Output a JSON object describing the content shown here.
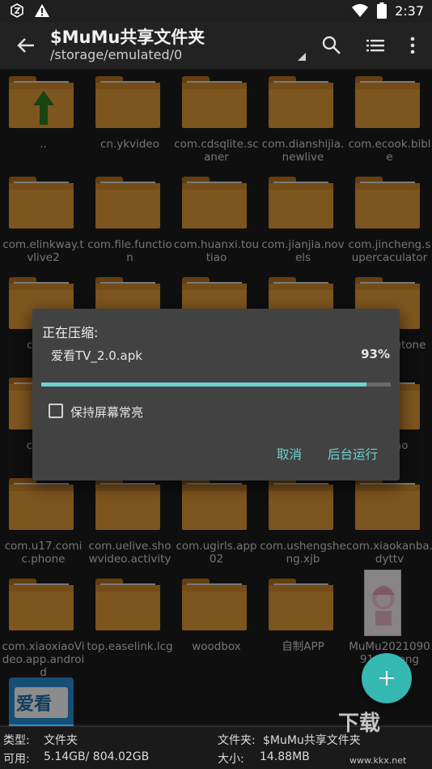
{
  "status_bar": {
    "time": "2:37"
  },
  "appbar": {
    "title": "$MuMu共享文件夹",
    "path": "/storage/emulated/0"
  },
  "files": [
    {
      "name": "..",
      "kind": "up"
    },
    {
      "name": "cn.ykvideo",
      "kind": "folder"
    },
    {
      "name": "com.cdsqlite.scaner",
      "kind": "folder"
    },
    {
      "name": "com.dianshijia.newlive",
      "kind": "folder"
    },
    {
      "name": "com.ecook.bible",
      "kind": "folder"
    },
    {
      "name": "com.elinkway.tvlive2",
      "kind": "folder"
    },
    {
      "name": "com.file.function",
      "kind": "folder"
    },
    {
      "name": "com.huanxi.toutiao",
      "kind": "folder"
    },
    {
      "name": "com.jianjia.novels",
      "kind": "folder"
    },
    {
      "name": "com.jincheng.supercaculator",
      "kind": "folder"
    },
    {
      "name": "com.ji",
      "kind": "folder"
    },
    {
      "name": "",
      "kind": "folder"
    },
    {
      "name": "",
      "kind": "folder"
    },
    {
      "name": "",
      "kind": "folder"
    },
    {
      "name": "uan.an gtone",
      "kind": "folder"
    },
    {
      "name": "com.p",
      "kind": "folder"
    },
    {
      "name": "",
      "kind": "folder"
    },
    {
      "name": "",
      "kind": "folder"
    },
    {
      "name": "",
      "kind": "folder"
    },
    {
      "name": "e.miao",
      "kind": "folder"
    },
    {
      "name": "com.u17.comic.phone",
      "kind": "folder"
    },
    {
      "name": "com.uelive.showvideo.activity",
      "kind": "folder"
    },
    {
      "name": "com.ugirls.app02",
      "kind": "folder"
    },
    {
      "name": "com.ushengsheng.xjb",
      "kind": "folder"
    },
    {
      "name": "com.xiaokanba.dyttv",
      "kind": "folder"
    },
    {
      "name": "com.xiaoxiaoVideo.app.android",
      "kind": "folder"
    },
    {
      "name": "top.easelink.lcg",
      "kind": "folder"
    },
    {
      "name": "woodbox",
      "kind": "folder"
    },
    {
      "name": "自制APP",
      "kind": "folder"
    },
    {
      "name": "MuMu20210909161...png",
      "kind": "image"
    },
    {
      "name": "",
      "kind": "tvapp",
      "icon_text": "爱看"
    }
  ],
  "dialog": {
    "title": "正在压缩:",
    "file": "爱看TV_2.0.apk",
    "percent_label": "93%",
    "progress": 0.93,
    "keep_screen_label": "保持屏幕常亮",
    "keep_screen_checked": false,
    "cancel_label": "取消",
    "background_label": "后台运行"
  },
  "footer": {
    "type_label": "类型:",
    "type_value": "文件夹",
    "avail_label": "可用:",
    "avail_value": "5.14GB/ 804.02GB",
    "folder_label": "文件夹:",
    "folder_value": "$MuMu共享文件夹",
    "size_label": "大小:",
    "size_value": "14.88MB"
  },
  "watermark": {
    "logo": "下载",
    "url": "www.kkx.net"
  },
  "colors": {
    "accent": "#6fd2cf",
    "folder": "#e39b3a",
    "fab": "#36b8b2"
  }
}
